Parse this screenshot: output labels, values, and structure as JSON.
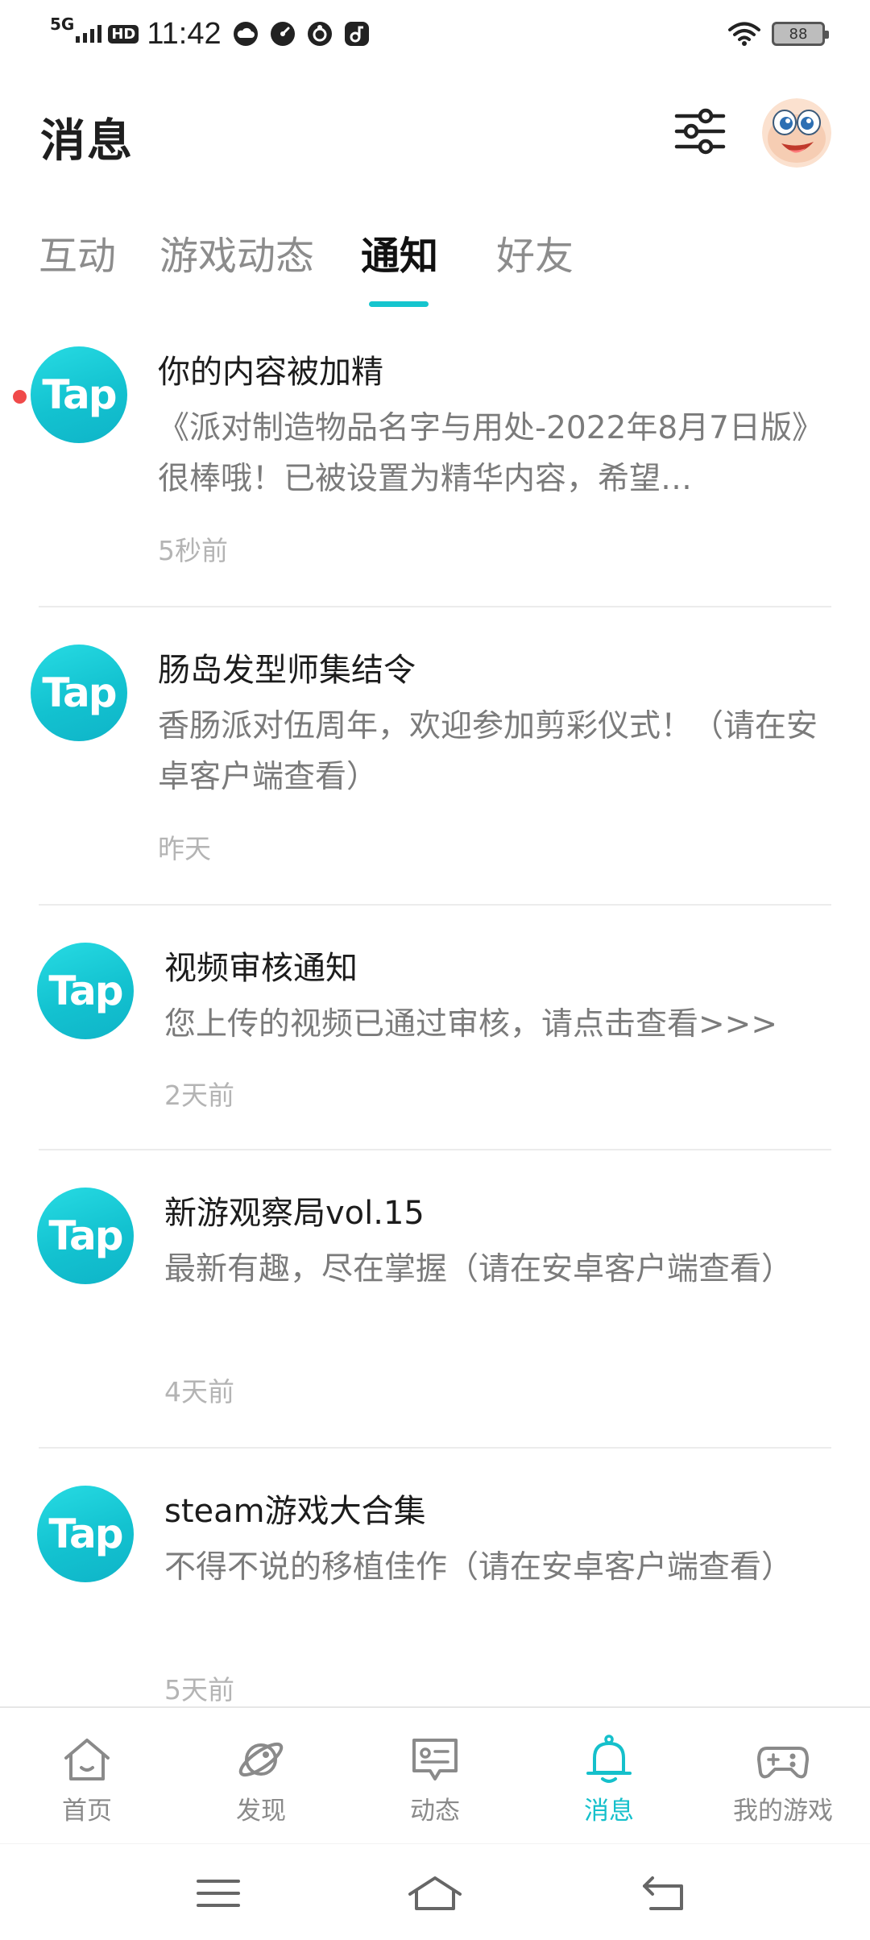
{
  "status_bar": {
    "network": "5G",
    "hd": "HD",
    "time": "11:42",
    "battery": "88",
    "icons": [
      "cloud-icon",
      "speed-icon",
      "assistant-icon",
      "music-icon",
      "wifi-icon",
      "battery-icon"
    ]
  },
  "header": {
    "title": "消息",
    "filter_icon": "sliders-icon",
    "avatar_icon": "avatar"
  },
  "tabs": [
    {
      "label": "互动",
      "active": false
    },
    {
      "label": "游戏动态",
      "active": false
    },
    {
      "label": "通知",
      "active": true
    },
    {
      "label": "好友",
      "active": false
    }
  ],
  "notifications": [
    {
      "logo": "Tap",
      "title": "你的内容被加精",
      "body": "《派对制造物品名字与用处-2022年8月7日版》很棒哦！已被设置为精华内容，希望…",
      "time": "5秒前",
      "unread": true
    },
    {
      "logo": "Tap",
      "title": "肠岛发型师集结令",
      "body": "香肠派对伍周年，欢迎参加剪彩仪式！（请在安卓客户端查看）",
      "time": "昨天",
      "unread": false
    },
    {
      "logo": "Tap",
      "title": "视频审核通知",
      "body": "您上传的视频已通过审核，请点击查看>>>",
      "time": "2天前",
      "unread": false
    },
    {
      "logo": "Tap",
      "title": "新游观察局vol.15",
      "body": "最新有趣，尽在掌握（请在安卓客户端查看）",
      "time": "4天前",
      "unread": false
    },
    {
      "logo": "Tap",
      "title": "steam游戏大合集",
      "body": "不得不说的移植佳作（请在安卓客户端查看）",
      "time": "5天前",
      "unread": false
    }
  ],
  "bottom_nav": [
    {
      "label": "首页",
      "icon": "home-icon",
      "active": false
    },
    {
      "label": "发现",
      "icon": "planet-icon",
      "active": false
    },
    {
      "label": "动态",
      "icon": "chat-icon",
      "active": false
    },
    {
      "label": "消息",
      "icon": "bell-icon",
      "active": true
    },
    {
      "label": "我的游戏",
      "icon": "gamepad-icon",
      "active": false
    }
  ],
  "colors": {
    "accent": "#15C5CE",
    "unread": "#F04A4A",
    "secondary_text": "#7B7B7B",
    "time_text": "#B4B4B4"
  }
}
